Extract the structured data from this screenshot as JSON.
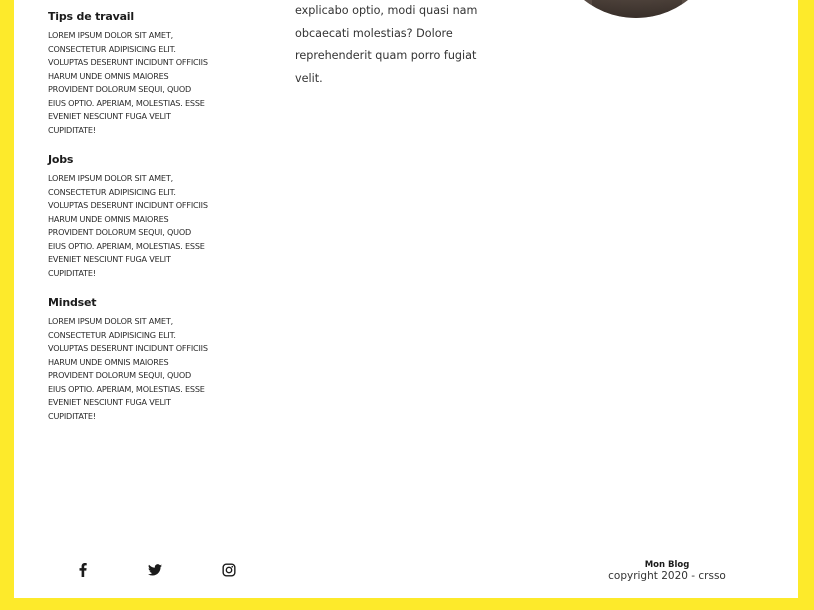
{
  "sidebar": {
    "sections": [
      {
        "title": "Tips de travail",
        "body": "Lorem ipsum dolor sit amet, consectetur adipisicing elit. Voluptas deserunt incidunt officiis harum unde omnis maiores provident dolorum sequi, quod eius optio. Aperiam, molestias. Esse eveniet nesciunt fuga velit cupiditate!"
      },
      {
        "title": "Jobs",
        "body": "Lorem ipsum dolor sit amet, consectetur adipisicing elit. Voluptas deserunt incidunt officiis harum unde omnis maiores provident dolorum sequi, quod eius optio. Aperiam, molestias. Esse eveniet nesciunt fuga velit cupiditate!"
      },
      {
        "title": "Mindset",
        "body": "Lorem ipsum dolor sit amet, consectetur adipisicing elit. Voluptas deserunt incidunt officiis harum unde omnis maiores provident dolorum sequi, quod eius optio. Aperiam, molestias. Esse eveniet nesciunt fuga velit cupiditate!"
      }
    ]
  },
  "main": {
    "paragraph_tail": "explicabo optio, modi quasi nam obcaecati molestias? Dolore reprehenderit quam porro fugiat velit."
  },
  "social": {
    "icons": [
      "facebook-icon",
      "twitter-icon",
      "instagram-icon"
    ]
  },
  "footer": {
    "title": "Mon Blog",
    "copyright": "copyright 2020 - crsso"
  },
  "colors": {
    "frame": "#fdea2b",
    "page": "#ffffff",
    "text": "#1b1b1b"
  }
}
